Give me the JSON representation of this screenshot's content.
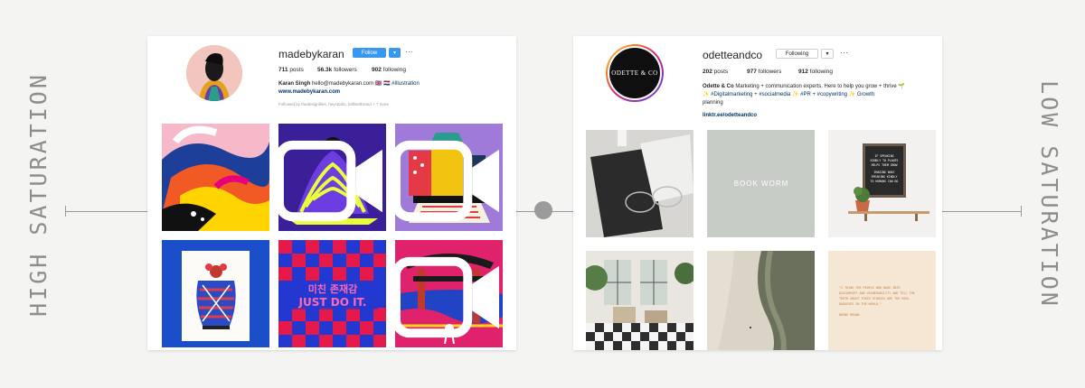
{
  "labels": {
    "left": "HIGH SATURATION",
    "right": "LOW SATURATION"
  },
  "left_profile": {
    "username": "madebykaran",
    "follow_label": "Follow",
    "dropdown_label": "▾",
    "more_label": "···",
    "posts_count": "711",
    "posts_label": "posts",
    "followers_count": "56.3k",
    "followers_label": "followers",
    "following_count": "902",
    "following_label": "following",
    "bio_name": "Karan Singh",
    "bio_text": "hello@madebykaran.com 🇬🇧 🇳🇱",
    "bio_tag": "#Illustration",
    "website": "www.madebykaran.com",
    "followed_by": "Followed by thedesignfiles, heystudio, brilliantbrand + 7 more",
    "tiles": [
      "abstract-stripes",
      "swirl-figure",
      "building-collage",
      "vase-illustration",
      "just-do-it-poster",
      "temple-gate"
    ]
  },
  "right_profile": {
    "username": "odetteandco",
    "avatar_text": "ODETTE & CO",
    "following_label": "Following",
    "dropdown_label": "▾",
    "more_label": "···",
    "posts_count": "202",
    "posts_label": "posts",
    "followers_count": "977",
    "followers_label": "followers",
    "following_count": "912",
    "following_label2": "following",
    "bio_name": "Odette & Co",
    "bio_line1": "Marketing + communication experts. Here to help you grow + thrive 🌱",
    "bio_line2": "✨ #Digitalmarketing + #socialmedia ✨ #PR + #copywriting ✨ Growth",
    "bio_line3": "planning",
    "website": "linktr.ee/odetteandco",
    "tiles": [
      "notebook-glasses",
      "book-worm",
      "letterboard-plant",
      "interior-room",
      "aerial-beach",
      "quote-card"
    ],
    "tile_book_worm": "BOOK WORM",
    "letterboard_text": "IF SPEAKING KINDLY TO PLANTS HELPS THEM GROW IMAGINE WHAT SPEAKING KINDLY TO HUMANS CAN DO",
    "quote_text": "\"I THINK THE PEOPLE WHO WADE INTO DISCOMFORT AND VULNERABILITY AND TELL THE TRUTH ABOUT THEIR STORIES ARE THE REAL BADASSES IN THE WORLD.\"",
    "quote_author": "BRENÉ BROWN"
  }
}
